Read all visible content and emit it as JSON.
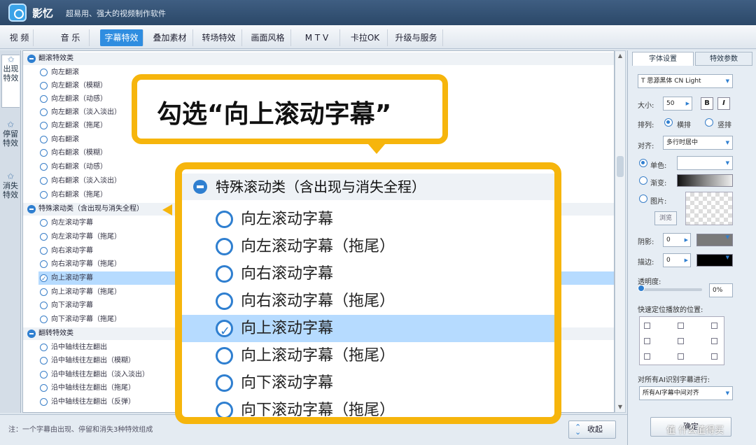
{
  "titlebar": {
    "app_name": "影忆",
    "slogan": "超易用、强大的视频制作软件"
  },
  "menubar": {
    "tabs": [
      "视 频",
      "音 乐",
      "字幕特效",
      "叠加素材",
      "转场特效",
      "画面风格",
      "M T V",
      "卡拉OK",
      "升级与服务"
    ],
    "active_index": 2
  },
  "left_tabs": [
    {
      "icon": "star-icon",
      "label": "出现特效"
    },
    {
      "icon": "star-icon",
      "label": "停留特效"
    },
    {
      "icon": "star-icon",
      "label": "消失特效"
    }
  ],
  "effect_list": {
    "categories": [
      {
        "label": "翻滚特效类",
        "items": [
          "向左翻滚",
          "向左翻滚（模糊）",
          "向左翻滚（动感）",
          "向左翻滚（淡入淡出）",
          "向左翻滚（拖尾）",
          "向右翻滚",
          "向右翻滚（模糊）",
          "向右翻滚（动感）",
          "向右翻滚（淡入淡出）",
          "向右翻滚（拖尾）"
        ]
      },
      {
        "label": "特殊滚动类（含出现与消失全程）",
        "items": [
          "向左滚动字幕",
          "向左滚动字幕（拖尾）",
          "向右滚动字幕",
          "向右滚动字幕（拖尾）",
          "向上滚动字幕",
          "向上滚动字幕（拖尾）",
          "向下滚动字幕",
          "向下滚动字幕（拖尾）"
        ],
        "selected_index": 4
      },
      {
        "label": "翻转特效类",
        "items": [
          "沿中轴线往左翻出",
          "沿中轴线往左翻出（模糊）",
          "沿中轴线往左翻出（淡入淡出）",
          "沿中轴线往左翻出（拖尾）",
          "沿中轴线往左翻出（反弹）"
        ]
      }
    ]
  },
  "bottom": {
    "note": "注：一个字幕由出现、停留和消失3种特效组成",
    "collapse_label": "收起"
  },
  "right_panel": {
    "tabs": [
      "字体设置",
      "特效参数"
    ],
    "font": "T 思源黑体 CN Light",
    "size_label": "大小:",
    "size_value": "50",
    "bold": "B",
    "italic": "I",
    "layout_label": "排列:",
    "layout_options": [
      "横排",
      "竖排"
    ],
    "align_label": "对齐:",
    "align_value": "多行时居中",
    "solid_label": "单色:",
    "gradient_label": "渐变:",
    "image_label": "图片:",
    "browse_label": "浏览",
    "shadow_label": "阴影:",
    "shadow_value": "0",
    "stroke_label": "描边:",
    "stroke_value": "0",
    "opacity_label": "透明度:",
    "opacity_value": "0%",
    "position_label": "快速定位播放的位置:",
    "ai_label": "对所有AI识别字幕进行:",
    "ai_value": "所有AI字幕中间对齐",
    "apply_label": "确定"
  },
  "colors": {
    "accent": "#2f7fd0",
    "callout": "#f6b50c",
    "selected_row": "#b6dbff",
    "shadow_color": "#7a7a7a",
    "stroke_color": "#000000"
  },
  "callout": {
    "text": "勾选“向上滚动字幕”"
  },
  "watermark": "值 什么值得买"
}
